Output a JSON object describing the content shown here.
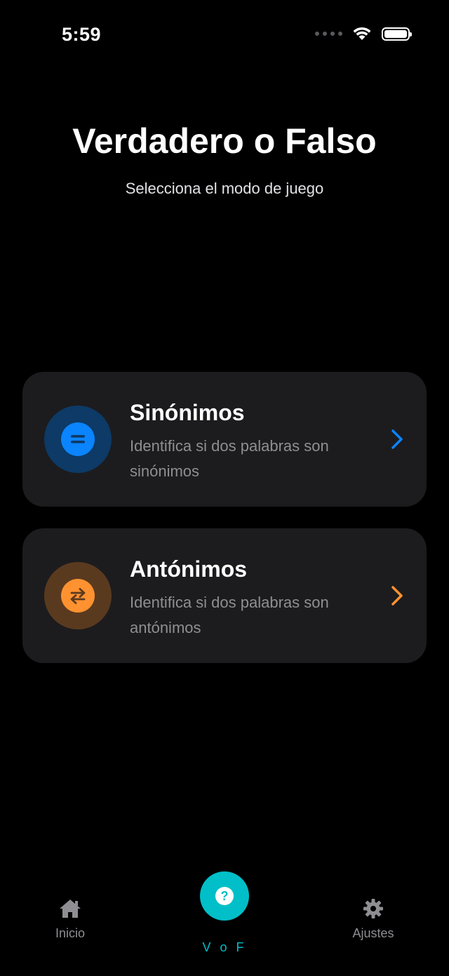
{
  "status_bar": {
    "time": "5:59"
  },
  "header": {
    "title": "Verdadero o Falso",
    "subtitle": "Selecciona el modo de juego"
  },
  "modes": [
    {
      "title": "Sinónimos",
      "description": "Identifica si dos palabras son sinónimos",
      "icon": "equals-icon",
      "accent_color": "#0a84ff",
      "icon_bg_color": "#0d3a66"
    },
    {
      "title": "Antónimos",
      "description": "Identifica si dos palabras son antónimos",
      "icon": "swap-arrows-icon",
      "accent_color": "#ff9230",
      "icon_bg_color": "#5a3a1f"
    }
  ],
  "tab_bar": {
    "home_label": "Inicio",
    "center_label": "V o F",
    "settings_label": "Ajustes",
    "center_color": "#00bfc8"
  }
}
